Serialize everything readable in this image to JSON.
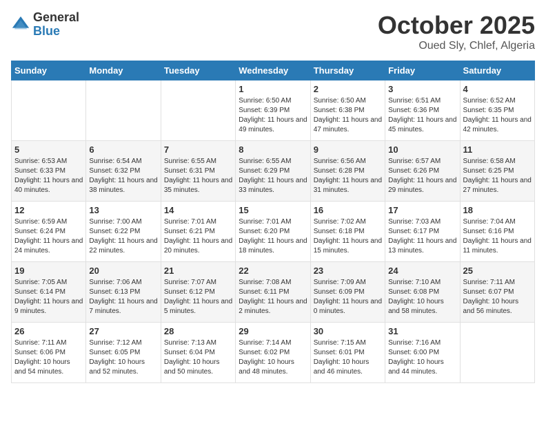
{
  "header": {
    "logo_general": "General",
    "logo_blue": "Blue",
    "month": "October 2025",
    "location": "Oued Sly, Chlef, Algeria"
  },
  "weekdays": [
    "Sunday",
    "Monday",
    "Tuesday",
    "Wednesday",
    "Thursday",
    "Friday",
    "Saturday"
  ],
  "weeks": [
    [
      {
        "day": "",
        "info": ""
      },
      {
        "day": "",
        "info": ""
      },
      {
        "day": "",
        "info": ""
      },
      {
        "day": "1",
        "info": "Sunrise: 6:50 AM\nSunset: 6:39 PM\nDaylight: 11 hours and 49 minutes."
      },
      {
        "day": "2",
        "info": "Sunrise: 6:50 AM\nSunset: 6:38 PM\nDaylight: 11 hours and 47 minutes."
      },
      {
        "day": "3",
        "info": "Sunrise: 6:51 AM\nSunset: 6:36 PM\nDaylight: 11 hours and 45 minutes."
      },
      {
        "day": "4",
        "info": "Sunrise: 6:52 AM\nSunset: 6:35 PM\nDaylight: 11 hours and 42 minutes."
      }
    ],
    [
      {
        "day": "5",
        "info": "Sunrise: 6:53 AM\nSunset: 6:33 PM\nDaylight: 11 hours and 40 minutes."
      },
      {
        "day": "6",
        "info": "Sunrise: 6:54 AM\nSunset: 6:32 PM\nDaylight: 11 hours and 38 minutes."
      },
      {
        "day": "7",
        "info": "Sunrise: 6:55 AM\nSunset: 6:31 PM\nDaylight: 11 hours and 35 minutes."
      },
      {
        "day": "8",
        "info": "Sunrise: 6:55 AM\nSunset: 6:29 PM\nDaylight: 11 hours and 33 minutes."
      },
      {
        "day": "9",
        "info": "Sunrise: 6:56 AM\nSunset: 6:28 PM\nDaylight: 11 hours and 31 minutes."
      },
      {
        "day": "10",
        "info": "Sunrise: 6:57 AM\nSunset: 6:26 PM\nDaylight: 11 hours and 29 minutes."
      },
      {
        "day": "11",
        "info": "Sunrise: 6:58 AM\nSunset: 6:25 PM\nDaylight: 11 hours and 27 minutes."
      }
    ],
    [
      {
        "day": "12",
        "info": "Sunrise: 6:59 AM\nSunset: 6:24 PM\nDaylight: 11 hours and 24 minutes."
      },
      {
        "day": "13",
        "info": "Sunrise: 7:00 AM\nSunset: 6:22 PM\nDaylight: 11 hours and 22 minutes."
      },
      {
        "day": "14",
        "info": "Sunrise: 7:01 AM\nSunset: 6:21 PM\nDaylight: 11 hours and 20 minutes."
      },
      {
        "day": "15",
        "info": "Sunrise: 7:01 AM\nSunset: 6:20 PM\nDaylight: 11 hours and 18 minutes."
      },
      {
        "day": "16",
        "info": "Sunrise: 7:02 AM\nSunset: 6:18 PM\nDaylight: 11 hours and 15 minutes."
      },
      {
        "day": "17",
        "info": "Sunrise: 7:03 AM\nSunset: 6:17 PM\nDaylight: 11 hours and 13 minutes."
      },
      {
        "day": "18",
        "info": "Sunrise: 7:04 AM\nSunset: 6:16 PM\nDaylight: 11 hours and 11 minutes."
      }
    ],
    [
      {
        "day": "19",
        "info": "Sunrise: 7:05 AM\nSunset: 6:14 PM\nDaylight: 11 hours and 9 minutes."
      },
      {
        "day": "20",
        "info": "Sunrise: 7:06 AM\nSunset: 6:13 PM\nDaylight: 11 hours and 7 minutes."
      },
      {
        "day": "21",
        "info": "Sunrise: 7:07 AM\nSunset: 6:12 PM\nDaylight: 11 hours and 5 minutes."
      },
      {
        "day": "22",
        "info": "Sunrise: 7:08 AM\nSunset: 6:11 PM\nDaylight: 11 hours and 2 minutes."
      },
      {
        "day": "23",
        "info": "Sunrise: 7:09 AM\nSunset: 6:09 PM\nDaylight: 11 hours and 0 minutes."
      },
      {
        "day": "24",
        "info": "Sunrise: 7:10 AM\nSunset: 6:08 PM\nDaylight: 10 hours and 58 minutes."
      },
      {
        "day": "25",
        "info": "Sunrise: 7:11 AM\nSunset: 6:07 PM\nDaylight: 10 hours and 56 minutes."
      }
    ],
    [
      {
        "day": "26",
        "info": "Sunrise: 7:11 AM\nSunset: 6:06 PM\nDaylight: 10 hours and 54 minutes."
      },
      {
        "day": "27",
        "info": "Sunrise: 7:12 AM\nSunset: 6:05 PM\nDaylight: 10 hours and 52 minutes."
      },
      {
        "day": "28",
        "info": "Sunrise: 7:13 AM\nSunset: 6:04 PM\nDaylight: 10 hours and 50 minutes."
      },
      {
        "day": "29",
        "info": "Sunrise: 7:14 AM\nSunset: 6:02 PM\nDaylight: 10 hours and 48 minutes."
      },
      {
        "day": "30",
        "info": "Sunrise: 7:15 AM\nSunset: 6:01 PM\nDaylight: 10 hours and 46 minutes."
      },
      {
        "day": "31",
        "info": "Sunrise: 7:16 AM\nSunset: 6:00 PM\nDaylight: 10 hours and 44 minutes."
      },
      {
        "day": "",
        "info": ""
      }
    ]
  ]
}
